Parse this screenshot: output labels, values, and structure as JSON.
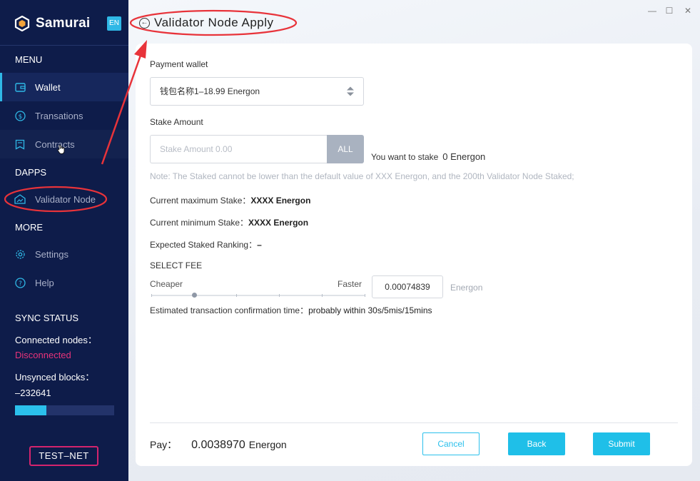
{
  "brand": {
    "name": "Samurai",
    "lang": "EN"
  },
  "sidebar": {
    "menu_label": "MENU",
    "menu_items": [
      {
        "label": "Wallet",
        "icon": "wallet-icon"
      },
      {
        "label": "Transations",
        "icon": "dollar-circle-icon"
      },
      {
        "label": "Contracts",
        "icon": "contract-icon"
      }
    ],
    "dapps_label": "DAPPS",
    "dapps_items": [
      {
        "label": "Validator Node",
        "icon": "validator-icon"
      }
    ],
    "more_label": "MORE",
    "more_items": [
      {
        "label": "Settings",
        "icon": "gear-icon"
      },
      {
        "label": "Help",
        "icon": "help-icon"
      }
    ]
  },
  "sync": {
    "title": "SYNC STATUS",
    "connected_label": "Connected nodes：",
    "connected_value": "Disconnected",
    "unsynced_label": "Unsynced blocks：",
    "unsynced_value": "–232641",
    "progress": 0.32
  },
  "network": "TEST–NET",
  "window": {
    "minimize": "—",
    "maximize": "☐",
    "close": "✕"
  },
  "header": {
    "title": "Validator Node Apply"
  },
  "form": {
    "payment_wallet_label": "Payment wallet",
    "payment_wallet_value": "钱包名称1–18.99 Energon",
    "stake_amount_label": "Stake Amount",
    "stake_amount_placeholder": "Stake Amount 0.00",
    "all_label": "ALL",
    "want_label": "You want to stake",
    "want_value": "0 Energon",
    "note": "Note: The Staked cannot be lower than the default value of XXX Energon, and the 200th Validator Node Staked;",
    "max_stake_label": "Current maximum Stake：",
    "max_stake_value": "XXXX Energon",
    "min_stake_label": "Current minimum Stake：",
    "min_stake_value": "XXXX Energon",
    "ranking_label": "Expected Staked Ranking：",
    "ranking_value": "–",
    "select_fee_label": "SELECT FEE",
    "cheaper_label": "Cheaper",
    "faster_label": "Faster",
    "fee_value": "0.00074839",
    "fee_unit": "Energon",
    "confirm_label": "Estimated transaction confirmation time：",
    "confirm_value": "probably within 30s/5mis/15mins",
    "fee_level": 0.2
  },
  "footer": {
    "pay_label": "Pay：",
    "pay_amount": "0.0038970",
    "pay_unit": "Energon",
    "cancel": "Cancel",
    "back": "Back",
    "submit": "Submit"
  },
  "colors": {
    "sidebar": "#0e1c4a",
    "accent": "#1fbfe8",
    "annotation": "#e8333a",
    "disconnected": "#e8337a"
  }
}
